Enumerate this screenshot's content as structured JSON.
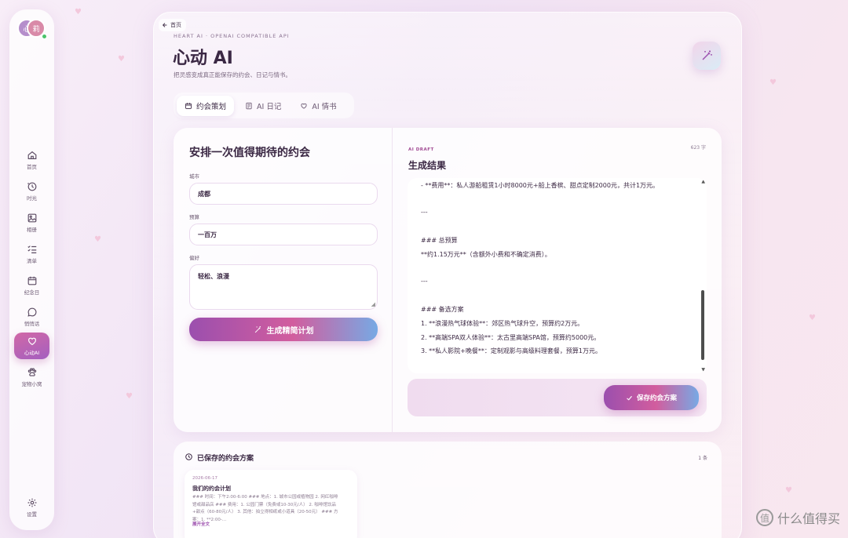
{
  "sidebar": {
    "avatars": [
      "心",
      "莉"
    ],
    "items": [
      {
        "label": "首页",
        "icon": "home-icon"
      },
      {
        "label": "时光",
        "icon": "history-icon"
      },
      {
        "label": "相册",
        "icon": "image-icon"
      },
      {
        "label": "清单",
        "icon": "checklist-icon"
      },
      {
        "label": "纪念日",
        "icon": "calendar-icon"
      },
      {
        "label": "悄悄话",
        "icon": "chat-icon"
      },
      {
        "label": "心动AI",
        "icon": "heart-ai-icon"
      },
      {
        "label": "宠物小窝",
        "icon": "paw-icon"
      }
    ],
    "settings_label": "设置"
  },
  "header": {
    "back_label": "首页",
    "eyebrow": "HEART AI · OPENAI COMPATIBLE API",
    "title": "心动 AI",
    "subtitle": "把灵感变成真正能保存的约会、日记与情书。"
  },
  "tabs": [
    {
      "label": "约会策划",
      "active": true,
      "icon": "calendar-icon"
    },
    {
      "label": "AI 日记",
      "active": false,
      "icon": "notebook-icon"
    },
    {
      "label": "AI 情书",
      "active": false,
      "icon": "heart-icon"
    }
  ],
  "form": {
    "title": "安排一次值得期待的约会",
    "city_label": "城市",
    "city_value": "成都",
    "budget_label": "预算",
    "budget_value": "一百万",
    "pref_label": "偏好",
    "pref_value": "轻松、浪漫",
    "generate_label": "生成精简计划"
  },
  "result": {
    "eyebrow": "AI DRAFT",
    "char_count": "623 字",
    "title": "生成结果",
    "lines": [
      "- **费用**：私人游船租赁1小时8000元+船上香槟、甜点定制2000元，共计1万元。",
      "",
      "---",
      "",
      "### 总预算",
      "**约1.15万元**（含额外小费和不确定消费）。",
      "",
      "---",
      "",
      "### 备选方案",
      "1. **浪漫热气球体验**：郊区热气球升空，预算约2万元。",
      "2. **高端SPA双人体验**：太古里高端SPA馆，预算约5000元。",
      "3. **私人影院+晚餐**：定制观影与高级料理套餐，预算1万元。"
    ],
    "save_label": "保存约会方案"
  },
  "saved": {
    "title": "已保存的约会方案",
    "count": "1 条",
    "cards": [
      {
        "date": "2026-06-17",
        "title": "我们的约会计划",
        "excerpt": "### 时间：下午2:00-6:00 ### 地点：1. 城市公园或植物园 2. 网红咖啡馆或甜品店 ### 费用：1. 公园门票（免费或10-30元/人） 2. 咖啡馆饮品+甜点（60-80元/人） 3. 其他：拍立得相纸或小道具（20-50元） ### 方案：1. **2:00-...",
        "link": "展开全文"
      }
    ]
  },
  "watermark": {
    "text": "什么值得买",
    "glyph": "值"
  },
  "colors": {
    "accent": "#d25d9e",
    "accent2": "#9b4fae",
    "accent3": "#77a9e4"
  }
}
